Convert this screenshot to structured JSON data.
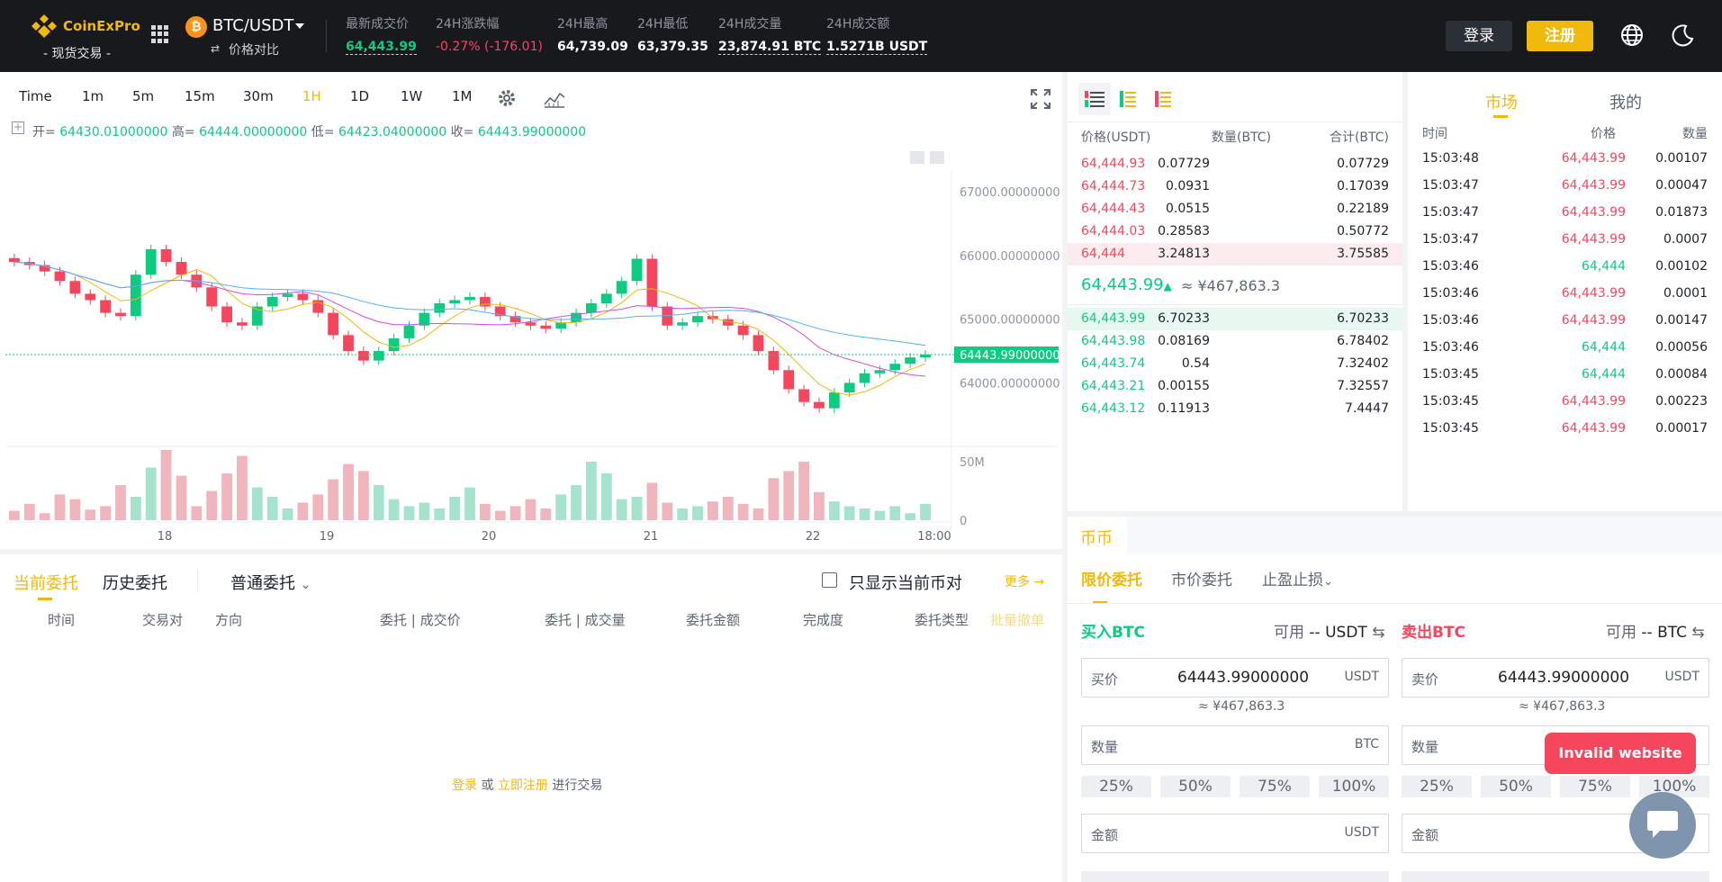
{
  "header": {
    "logo_text": "CoinExPro",
    "logo_sub": "- 现货交易 -",
    "pair": "BTC/USDT",
    "coin_symbol": "₿",
    "compare_label": "价格对比",
    "stats": [
      {
        "label": "最新成交价",
        "value": "64,443.99",
        "color": "green",
        "underline": true
      },
      {
        "label": "24H涨跌幅",
        "value": "-0.27% (-176.01)",
        "color": "red",
        "underline": false
      },
      {
        "label": "24H最高",
        "value": "64,739.09",
        "color": "white",
        "underline": false
      },
      {
        "label": "24H最低",
        "value": "63,379.35",
        "color": "white",
        "underline": false
      },
      {
        "label": "24H成交量",
        "value": "23,874.91 BTC",
        "color": "white",
        "underline": true
      },
      {
        "label": "24H成交额",
        "value": "1.5271B USDT",
        "color": "white",
        "underline": true
      }
    ],
    "login": "登录",
    "register": "注册",
    "icons": [
      "grid-icon",
      "globe-icon",
      "moon-icon"
    ]
  },
  "chart": {
    "timeframes": [
      "Time",
      "1m",
      "5m",
      "15m",
      "30m",
      "1H",
      "1D",
      "1W",
      "1M"
    ],
    "active_timeframe": "1H",
    "ohlc": {
      "open_label": "开=",
      "open": "64430.01000000",
      "high_label": "高=",
      "high": "64444.00000000",
      "low_label": "低=",
      "low": "64423.04000000",
      "close_label": "收=",
      "close": "64443.99000000"
    },
    "price_ticks": [
      "67000.00000000",
      "66000.00000000",
      "65000.00000000",
      "64000.00000000"
    ],
    "current_price_tag": "64443.99000000",
    "volume_ticks": [
      "50M",
      "0"
    ],
    "date_ticks": [
      "18",
      "19",
      "20",
      "21",
      "22",
      "18:00"
    ]
  },
  "chart_data": {
    "type": "candlestick",
    "title": "",
    "xlabel": "",
    "ylabel": "",
    "ylim": [
      63200,
      67300
    ],
    "close_path": [
      65900,
      65850,
      65750,
      65600,
      65400,
      65300,
      65100,
      65050,
      65700,
      66100,
      65900,
      65700,
      65500,
      65200,
      64950,
      64900,
      65200,
      65350,
      65400,
      65300,
      65100,
      64750,
      64500,
      64350,
      64500,
      64700,
      64900,
      65100,
      65250,
      65300,
      65350,
      65200,
      65050,
      64950,
      64900,
      64850,
      64950,
      65100,
      65250,
      65400,
      65600,
      65950,
      65200,
      64900,
      64950,
      65050,
      65000,
      64900,
      64750,
      64500,
      64200,
      63900,
      63700,
      63600,
      63850,
      64000,
      64150,
      64200,
      64300,
      64400,
      64444
    ],
    "current_price": 64443.99,
    "volume_ylim": [
      0,
      60
    ],
    "volume": [
      8,
      14,
      6,
      22,
      18,
      9,
      12,
      30,
      20,
      45,
      60,
      38,
      12,
      25,
      40,
      55,
      28,
      20,
      10,
      15,
      22,
      35,
      48,
      42,
      30,
      18,
      12,
      15,
      10,
      20,
      28,
      14,
      8,
      12,
      18,
      10,
      22,
      30,
      50,
      40,
      18,
      20,
      32,
      15,
      10,
      12,
      16,
      20,
      14,
      10,
      36,
      42,
      50,
      24,
      16,
      12,
      10,
      8,
      12,
      6,
      14
    ]
  },
  "orderbook": {
    "icons": [
      "orderbook-both-icon",
      "orderbook-buy-icon",
      "orderbook-sell-icon"
    ],
    "headers": [
      "价格(USDT)",
      "数量(BTC)",
      "合计(BTC)"
    ],
    "asks": [
      [
        "64,444.93",
        "0.07729",
        "0.07729"
      ],
      [
        "64,444.73",
        "0.0931",
        "0.17039"
      ],
      [
        "64,444.43",
        "0.0515",
        "0.22189"
      ],
      [
        "64,444.03",
        "0.28583",
        "0.50772"
      ],
      [
        "64,444",
        "3.24813",
        "3.75585"
      ]
    ],
    "mid_price": "64,443.99",
    "mid_arrow": "▲",
    "mid_cny": "≈ ¥467,863.3",
    "bids": [
      [
        "64,443.99",
        "6.70233",
        "6.70233"
      ],
      [
        "64,443.98",
        "0.08169",
        "6.78402"
      ],
      [
        "64,443.74",
        "0.54",
        "7.32402"
      ],
      [
        "64,443.21",
        "0.00155",
        "7.32557"
      ],
      [
        "64,443.12",
        "0.11913",
        "7.4447"
      ]
    ]
  },
  "trades": {
    "tabs": [
      "市场",
      "我的"
    ],
    "headers": [
      "时间",
      "价格",
      "数量"
    ],
    "rows": [
      [
        "15:03:48",
        "64,443.99",
        "0.00107",
        "red"
      ],
      [
        "15:03:47",
        "64,443.99",
        "0.00047",
        "red"
      ],
      [
        "15:03:47",
        "64,443.99",
        "0.01873",
        "red"
      ],
      [
        "15:03:47",
        "64,443.99",
        "0.0007",
        "red"
      ],
      [
        "15:03:46",
        "64,444",
        "0.00102",
        "green"
      ],
      [
        "15:03:46",
        "64,443.99",
        "0.0001",
        "red"
      ],
      [
        "15:03:46",
        "64,443.99",
        "0.00147",
        "red"
      ],
      [
        "15:03:46",
        "64,444",
        "0.00056",
        "green"
      ],
      [
        "15:03:45",
        "64,444",
        "0.00084",
        "green"
      ],
      [
        "15:03:45",
        "64,443.99",
        "0.00223",
        "red"
      ],
      [
        "15:03:45",
        "64,443.99",
        "0.00017",
        "red"
      ]
    ]
  },
  "orders": {
    "tab_current": "当前委托",
    "tab_history": "历史委托",
    "order_type": "普通委托",
    "only_current": "只显示当前币对",
    "more": "更多 →",
    "columns": [
      "时间",
      "交易对",
      "方向",
      "委托 | 成交价",
      "委托 | 成交量",
      "委托金额",
      "完成度",
      "委托类型",
      "批量撤单"
    ],
    "empty_login": "登录",
    "empty_or": " 或 ",
    "empty_register": "立即注册",
    "empty_trade": " 进行交易"
  },
  "form": {
    "market_tab": "币币",
    "tabs": [
      "限价委托",
      "市价委托",
      "止盈止损"
    ],
    "buy": {
      "title": "买入BTC",
      "avail_label": "可用",
      "avail_value": "-- USDT",
      "price_label": "买价",
      "price_value": "64443.99000000",
      "price_unit": "USDT",
      "price_cny": "≈ ¥467,863.3",
      "qty_label": "数量",
      "qty_unit": "BTC",
      "amount_label": "金额",
      "amount_unit": "USDT"
    },
    "sell": {
      "title": "卖出BTC",
      "avail_label": "可用",
      "avail_value": "-- BTC",
      "price_label": "卖价",
      "price_value": "64443.99000000",
      "price_unit": "USDT",
      "price_cny": "≈ ¥467,863.3",
      "qty_label": "数量",
      "amount_label": "金额"
    },
    "percents": [
      "25%",
      "50%",
      "75%",
      "100%"
    ]
  },
  "toast": "Invalid website",
  "colors": {
    "accent": "#f0b90b",
    "up": "#0ecb81",
    "down": "#f6465d",
    "header_bg": "#17191d"
  }
}
